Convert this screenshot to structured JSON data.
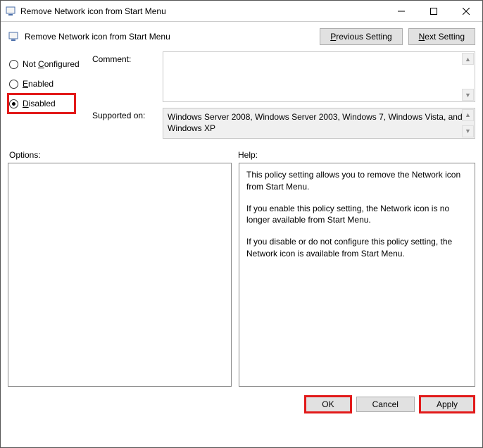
{
  "window": {
    "title": "Remove Network icon from Start Menu"
  },
  "subheader": {
    "title": "Remove Network icon from Start Menu",
    "prev": "Previous Setting",
    "next": "Next Setting"
  },
  "radios": {
    "not_configured": "Not Configured",
    "enabled": "Enabled",
    "disabled": "Disabled",
    "selected": "disabled"
  },
  "labels": {
    "comment": "Comment:",
    "supported": "Supported on:",
    "options": "Options:",
    "help": "Help:"
  },
  "supported_text": "Windows Server 2008, Windows Server 2003, Windows 7, Windows Vista, and Windows XP",
  "help_paragraphs": [
    "This policy setting allows you to remove the Network icon from Start Menu.",
    "If you enable this policy setting, the Network icon is no longer available from Start Menu.",
    "If you disable or do not configure this policy setting, the Network icon is available from Start Menu."
  ],
  "buttons": {
    "ok": "OK",
    "cancel": "Cancel",
    "apply": "Apply"
  }
}
